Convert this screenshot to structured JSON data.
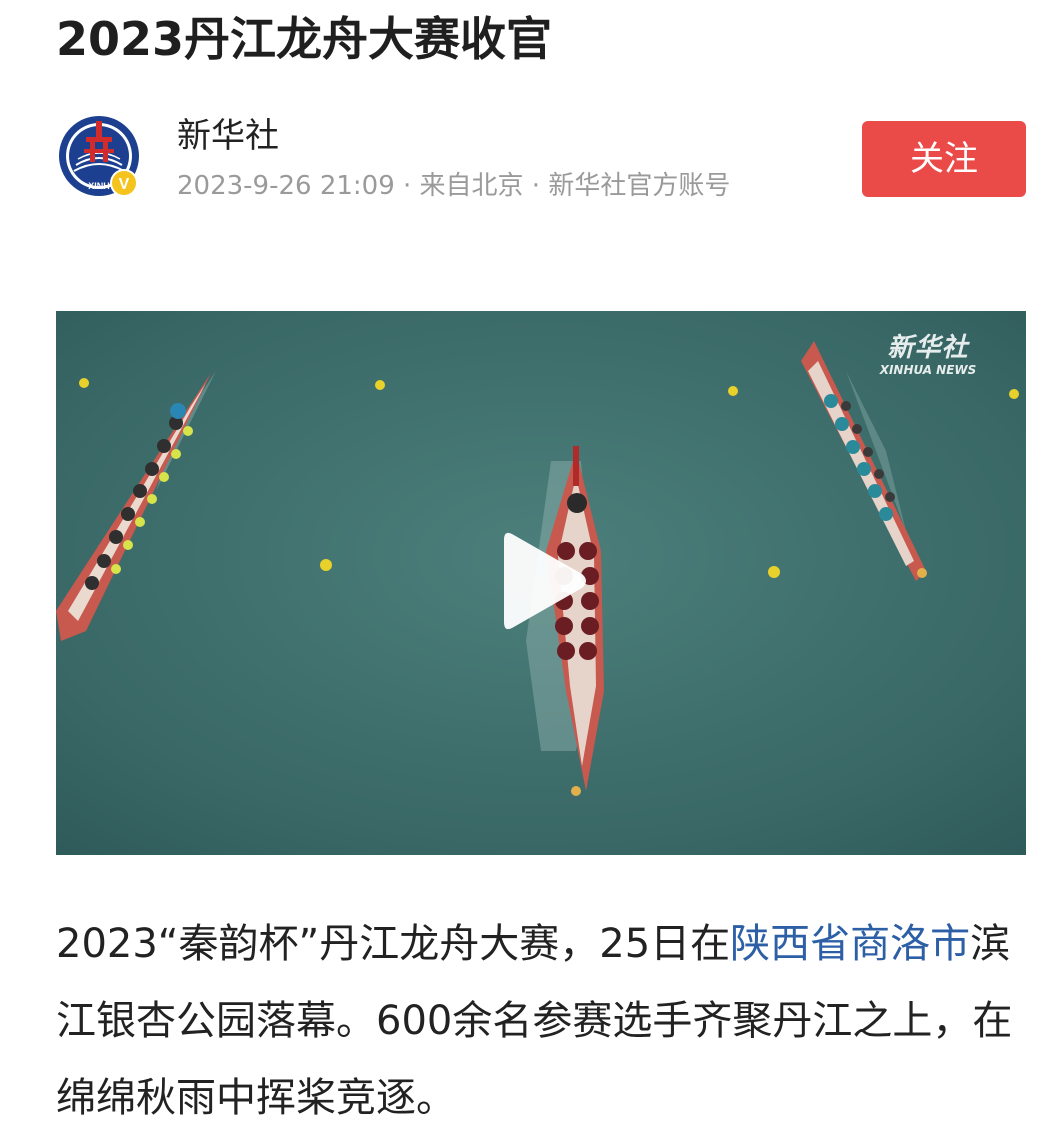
{
  "article": {
    "title": "2023丹江龙舟大赛收官"
  },
  "author": {
    "name": "新华社",
    "meta": "2023-9-26 21:09 · 来自北京 · 新华社官方账号",
    "avatar_icon": "xinhua-logo-icon",
    "verified_icon": "verified-v-icon",
    "avatar_text": "XINH",
    "verified_badge": "V"
  },
  "follow_button": {
    "label": "关注",
    "color": "#ea4b49"
  },
  "video": {
    "watermark_cn": "新华社",
    "watermark_en": "XINHUA NEWS",
    "play_icon": "play-icon"
  },
  "body": {
    "part1": "2023“秦韵杯”丹江龙舟大赛，25日在",
    "link": "陕西省商洛市",
    "part2": "滨江银杏公园落幕。600余名参赛选手齐聚丹江之上，在绵绵秋雨中挥桨竞逐。",
    "link_color": "#2d5fa6"
  }
}
